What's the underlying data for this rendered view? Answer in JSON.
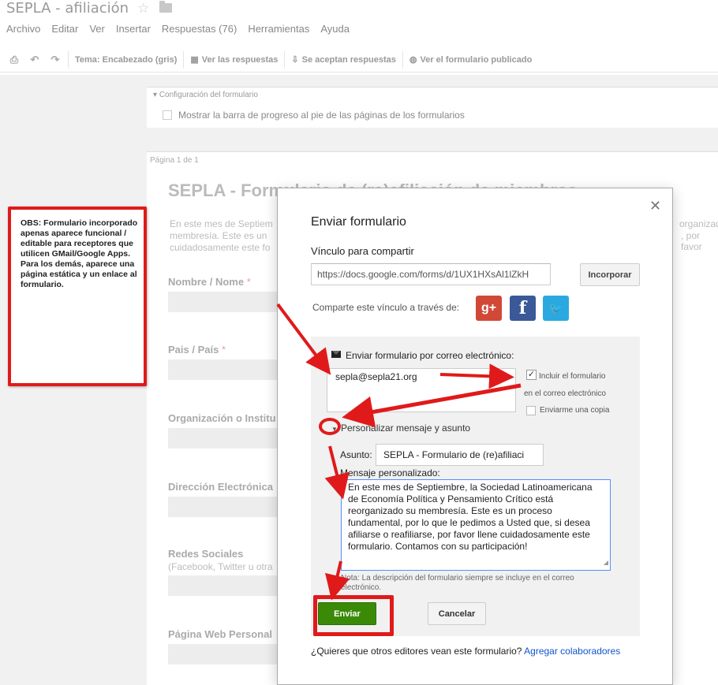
{
  "app": {
    "title": "SEPLA - afiliación"
  },
  "menu": [
    "Archivo",
    "Editar",
    "Ver",
    "Insertar",
    "Respuestas (76)",
    "Herramientas",
    "Ayuda"
  ],
  "toolbar": {
    "theme": "Tema: Encabezado (gris)",
    "view_responses": "Ver las respuestas",
    "accepting": "Se aceptan respuestas",
    "view_published": "Ver el formulario publicado"
  },
  "config": {
    "heading": "Configuración del formulario",
    "progress_label": "Mostrar la barra de progreso al pie de las páginas de los formularios"
  },
  "form": {
    "page_label": "Página 1 de 1",
    "title": "SEPLA - Formulario de (re)afiliación de miembros",
    "desc_line1": "En este mes de Septiem",
    "desc_line2": "membresía. Este es un",
    "desc_line3": "cuidadosamente este fo",
    "desc_right1": "organizad",
    "desc_right2": ", por favor",
    "questions": [
      {
        "label": "Nombre / Nome",
        "required": true,
        "help": ""
      },
      {
        "label": "Pais / País",
        "required": true,
        "help": ""
      },
      {
        "label": "Organización o Institu",
        "required": false,
        "help": ""
      },
      {
        "label": "Dirección Electrónica",
        "required": false,
        "help": ""
      },
      {
        "label": "Redes Sociales",
        "required": false,
        "help": "(Facebook, Twitter u otra"
      },
      {
        "label": "Página Web Personal",
        "required": false,
        "help": ""
      }
    ]
  },
  "annotation_note": "OBS: Formulario incorporado apenas aparece funcional / editable para receptores que utilicen GMail/Google Apps. Para los demás, aparece una página estática y un enlace al formulario.",
  "dialog": {
    "title": "Enviar formulario",
    "share_link_label": "Vínculo para compartir",
    "share_link": "https://docs.google.com/forms/d/1UX1HXsAl1lZkH",
    "embed_button": "Incorporar",
    "share_via": "Comparte este vínculo a través de:",
    "social": [
      "google-plus",
      "facebook",
      "twitter"
    ],
    "email_heading": "Enviar formulario por correo electrónico:",
    "to_value": "sepla@sepla21.org",
    "include_form_label1": "Incluir el formulario",
    "include_form_label2": "en el correo electrónico",
    "include_form_checked": true,
    "send_copy_label": "Enviarme una copia",
    "send_copy_checked": false,
    "customize_label": "Personalizar mensaje y asunto",
    "subject_label": "Asunto:",
    "subject_value": "SEPLA - Formulario de (re)afiliaci",
    "message_label": "Mensaje personalizado:",
    "message_value": "En este mes de Septiembre, la Sociedad Latinoamericana de Economía Política y Pensamiento Crítico está reorganizado su membresía. Este es un proceso fundamental, por lo que le pedimos a Usted que, si desea afiliarse o reafiliarse, por favor llene cuidadosamente este formulario. Contamos con su participación!",
    "note": "Nota: La descripción del formulario siempre se incluye en el correo electrónico.",
    "send_button": "Enviar",
    "cancel_button": "Cancelar",
    "collab_text": "¿Quieres que otros editores vean este formulario?",
    "collab_link": "Agregar colaboradores"
  },
  "colors": {
    "annotation_red": "#e01a1a",
    "send_green": "#3a8a08",
    "link_blue": "#1155cc"
  }
}
